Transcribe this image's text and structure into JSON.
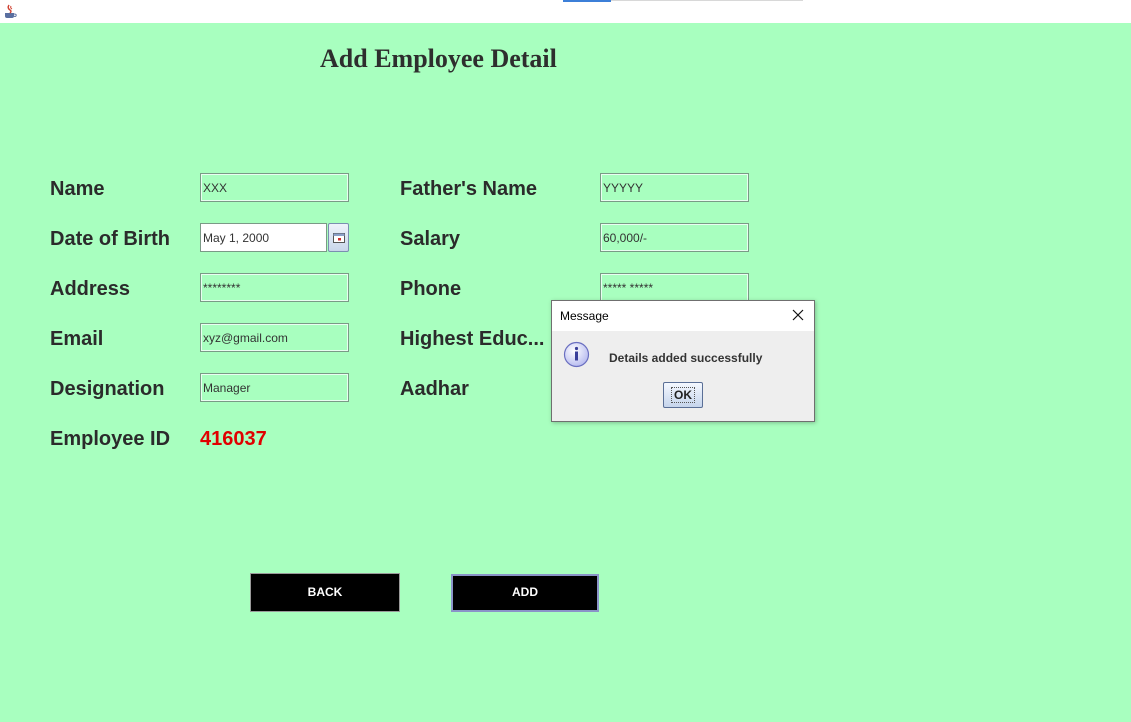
{
  "form": {
    "title": "Add Employee Detail",
    "labels": {
      "name": "Name",
      "dob": "Date of Birth",
      "address": "Address",
      "email": "Email",
      "designation": "Designation",
      "empid": "Employee ID",
      "father": "Father's Name",
      "salary": "Salary",
      "phone": "Phone",
      "education": "Highest Educ...",
      "aadhar": "Aadhar"
    },
    "values": {
      "name": "XXX",
      "dob": "May 1, 2000",
      "address": "********",
      "email": "xyz@gmail.com",
      "designation": "Manager",
      "empid": "416037",
      "father": "YYYYY",
      "salary": "60,000/-",
      "phone": "***** *****"
    },
    "buttons": {
      "back": "BACK",
      "add": "ADD"
    }
  },
  "dialog": {
    "title": "Message",
    "message": "Details added successfully",
    "ok": "OK"
  },
  "colors": {
    "background": "#a8ffbf",
    "employee_id": "#e00000",
    "button": "#000000"
  },
  "icons": {
    "app": "java-coffee-icon",
    "calendar": "calendar-icon",
    "info": "info-icon",
    "close": "close-icon"
  }
}
